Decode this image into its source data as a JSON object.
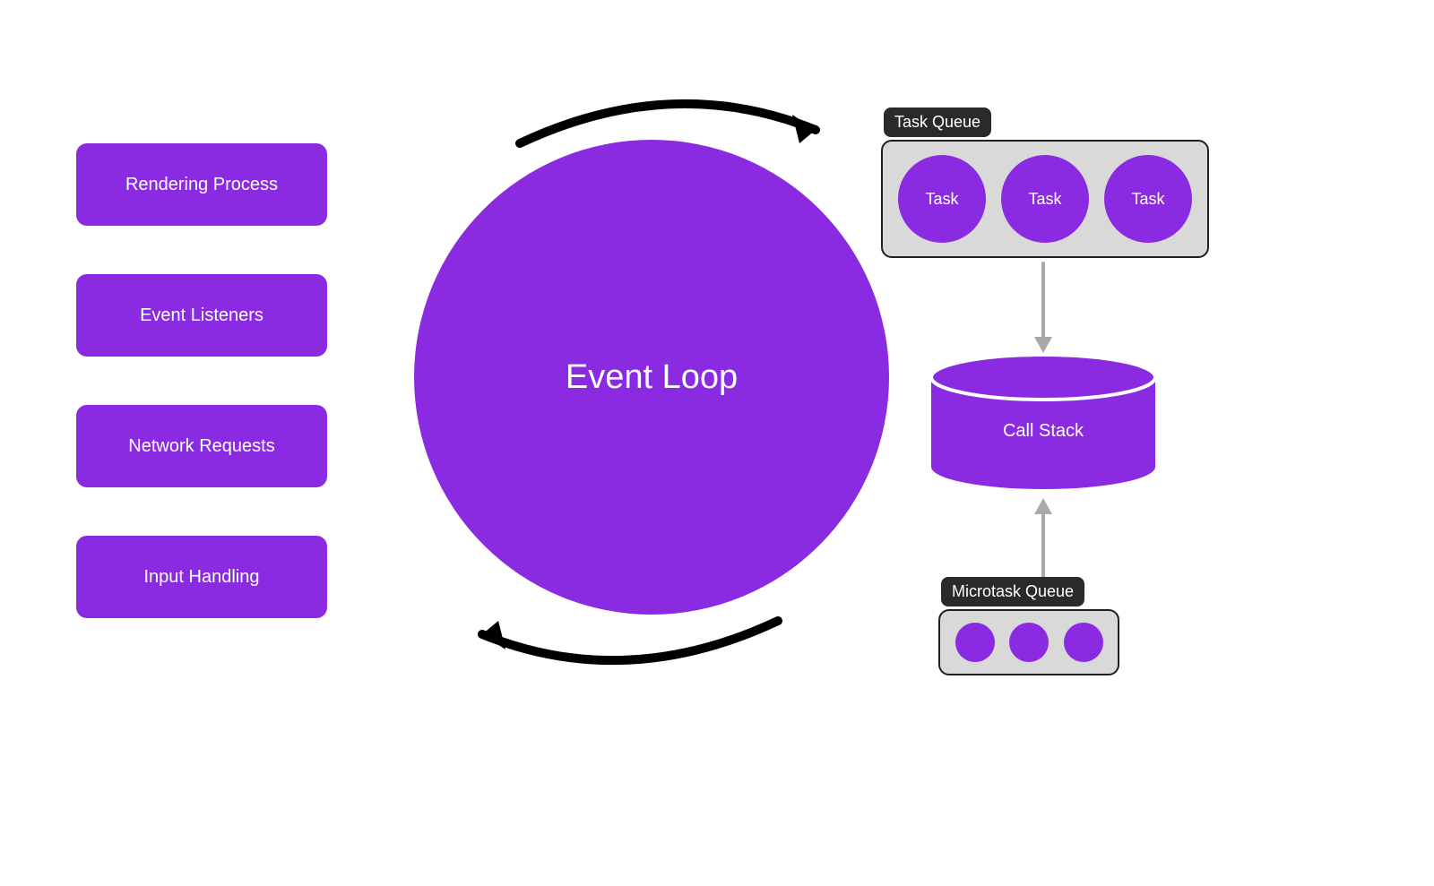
{
  "colors": {
    "purple": "#8A2BE2",
    "gray": "#D9D9D9",
    "dark": "#2A2A2A",
    "arrow_gray": "#A9A9A9"
  },
  "left_boxes": [
    "Rendering Process",
    "Event Listeners",
    "Network Requests",
    "Input Handling"
  ],
  "center": {
    "label": "Event Loop"
  },
  "task_queue": {
    "label": "Task Queue",
    "items": [
      "Task",
      "Task",
      "Task"
    ]
  },
  "call_stack": {
    "label": "Call Stack"
  },
  "microtask_queue": {
    "label": "Microtask Queue",
    "items": [
      "",
      "",
      ""
    ]
  }
}
